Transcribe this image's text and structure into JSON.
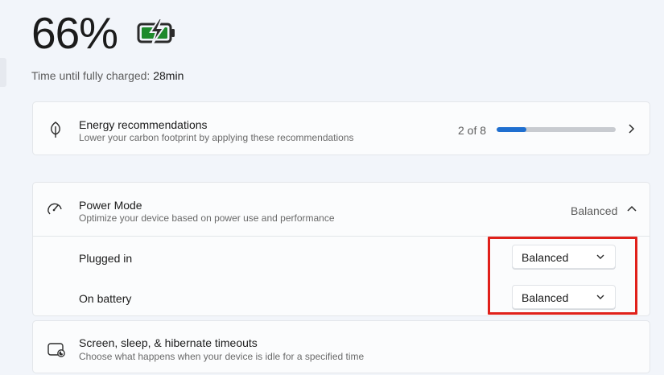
{
  "battery": {
    "percent": "66%",
    "charge_label": "Time until fully charged:",
    "charge_value": "28min",
    "level": 0.66
  },
  "energy": {
    "title": "Energy recommendations",
    "subtitle": "Lower your carbon footprint by applying these recommendations",
    "count": "2 of 8",
    "progress_fraction": 0.25,
    "icon": "leaf-icon"
  },
  "power_mode": {
    "title": "Power Mode",
    "subtitle": "Optimize your device based on power use and performance",
    "value": "Balanced",
    "icon": "speedometer-icon",
    "rows": [
      {
        "label": "Plugged in",
        "selected": "Balanced"
      },
      {
        "label": "On battery",
        "selected": "Balanced"
      }
    ]
  },
  "screen_sleep": {
    "title": "Screen, sleep, & hibernate timeouts",
    "subtitle": "Choose what happens when your device is idle for a specified time",
    "icon": "screen-sleep-icon"
  },
  "colors": {
    "accent": "#1f6fd0",
    "battery_green": "#1e8a2c",
    "highlight": "#e0201a"
  }
}
